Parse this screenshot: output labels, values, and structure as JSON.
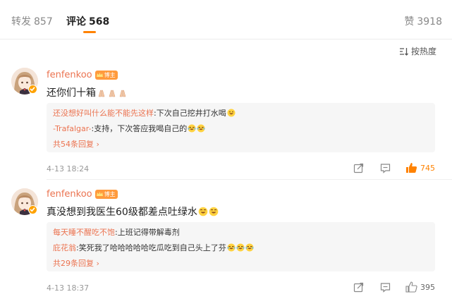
{
  "tabs": {
    "repost": {
      "label": "转发",
      "count": "857"
    },
    "comment": {
      "label": "评论",
      "count": "568"
    },
    "like": {
      "label": "赞",
      "count": "3918"
    }
  },
  "sort": {
    "label": "按热度"
  },
  "comments": [
    {
      "user": "fenfenkoo",
      "badge": "博主",
      "text": "还你们十箱",
      "text_emoji": "pray-emoji",
      "replies": [
        {
          "name": "还没想好叫什么能不能先这样",
          "sep": ": ",
          "text": "下次自己挖井打水喝",
          "emoji": "grin-emoji"
        },
        {
          "name": "-Trafalgar-",
          "sep": ": ",
          "text": "支持，下次答应我喝自己的",
          "emoji": "laugh-cry-emoji"
        }
      ],
      "more": "共54条回复",
      "time": "4-13 18:24",
      "likes": "745",
      "liked": true
    },
    {
      "user": "fenfenkoo",
      "badge": "博主",
      "text": "真没想到我医生60级都差点吐绿水",
      "text_emoji": "grin-emoji",
      "replies": [
        {
          "name": "每天睡不醒吃不饱",
          "sep": ": ",
          "text": "上班记得带解毒剂",
          "emoji": ""
        },
        {
          "name": "庇花翁",
          "sep": ": ",
          "text": "笑死我了哈哈哈哈哈吃瓜吃到自己头上了芬",
          "emoji": "laugh-cry-emoji"
        }
      ],
      "more": "共29条回复",
      "time": "4-13 18:37",
      "likes": "395",
      "liked": false
    }
  ],
  "colors": {
    "accent": "#ff8200",
    "name": "#eb7350",
    "like_active": "#ff8200"
  }
}
